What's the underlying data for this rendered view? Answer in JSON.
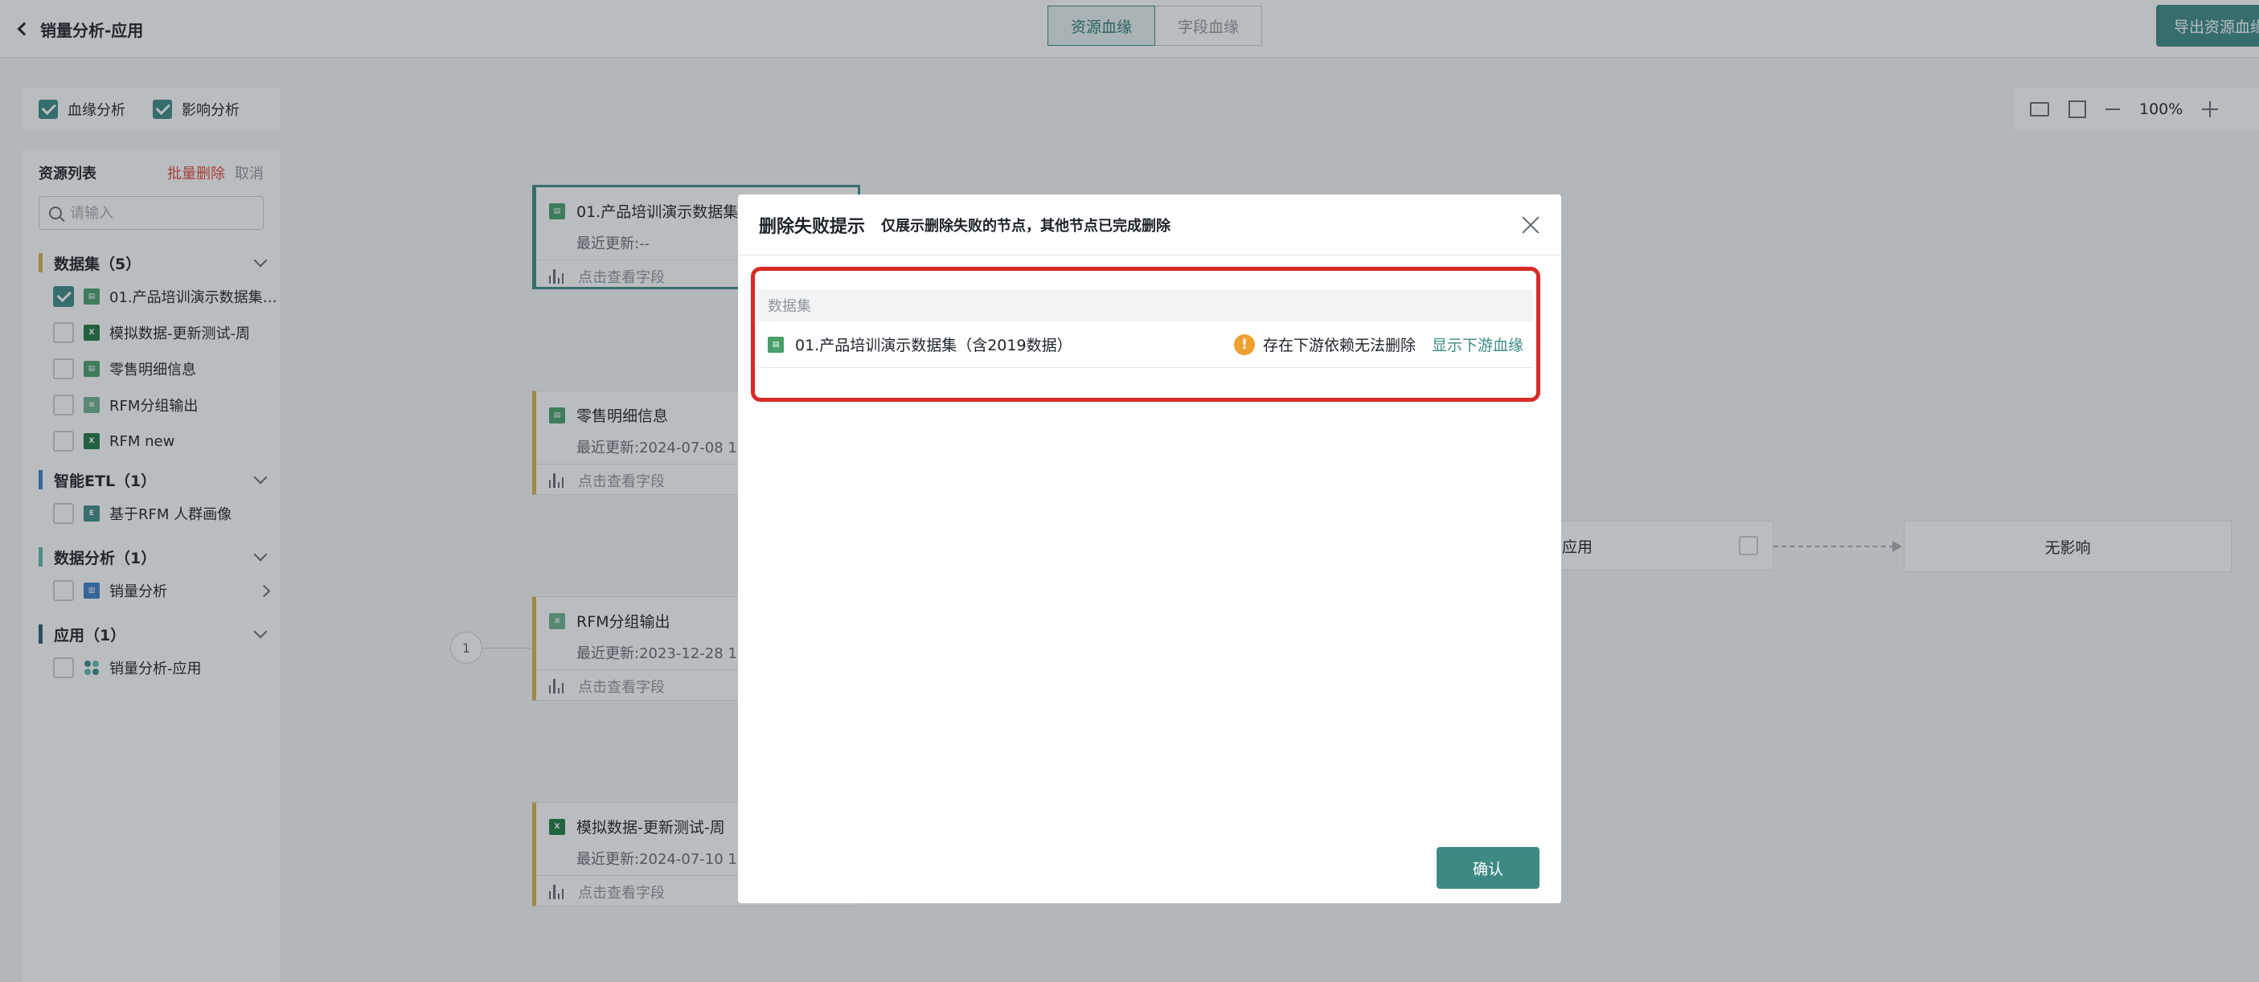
{
  "header": {
    "title": "销量分析-应用",
    "tabs": [
      {
        "label": "资源血缘",
        "active": true
      },
      {
        "label": "字段血缘",
        "active": false
      }
    ],
    "export_label": "导出资源血缘"
  },
  "analysis_options": {
    "lineage_label": "血缘分析",
    "lineage_checked": true,
    "impact_label": "影响分析",
    "impact_checked": true
  },
  "resource_panel": {
    "title": "资源列表",
    "batch_delete": "批量删除",
    "cancel": "取消",
    "search_placeholder": "请输入",
    "groups": [
      {
        "label": "数据集（5）",
        "color": "#d9b44a",
        "items": [
          {
            "label": "01.产品培训演示数据集（含2019数据）",
            "icon": "sheet-icon",
            "checked": true
          },
          {
            "label": "模拟数据-更新测试-周",
            "icon": "excel-icon",
            "checked": false
          },
          {
            "label": "零售明细信息",
            "icon": "sheet-icon",
            "checked": false
          },
          {
            "label": "RFM分组输出",
            "icon": "rfm-icon",
            "checked": false
          },
          {
            "label": "RFM new",
            "icon": "excel-icon",
            "checked": false
          }
        ]
      },
      {
        "label": "智能ETL（1）",
        "color": "#3c7fc6",
        "items": [
          {
            "label": "基于RFM 人群画像",
            "icon": "etl-icon",
            "checked": false
          }
        ]
      },
      {
        "label": "数据分析（1）",
        "color": "#5fb8b0",
        "items": [
          {
            "label": "销量分析",
            "icon": "analysis-icon",
            "checked": false
          }
        ]
      },
      {
        "label": "应用（1）",
        "color": "#2f5e6e",
        "items": [
          {
            "label": "销量分析-应用",
            "icon": "app-icon",
            "checked": false
          }
        ]
      }
    ]
  },
  "canvas": {
    "zoom_label": "100%",
    "count_badge": "1",
    "fields_label": "点击查看字段",
    "nodes": [
      {
        "name": "01.产品培训演示数据集",
        "updated": "最近更新:--"
      },
      {
        "name": "零售明细信息",
        "updated": "最近更新:2024-07-08 1"
      },
      {
        "name": "RFM分组输出",
        "updated": "最近更新:2023-12-28 1"
      },
      {
        "name": "模拟数据-更新测试-周",
        "updated": "最近更新:2024-07-10 1"
      }
    ],
    "app_node_label": "应用",
    "no_impact_label": "无影响"
  },
  "modal": {
    "title": "删除失败提示",
    "subtitle": "仅展示删除失败的节点，其他节点已完成删除",
    "table_header": "数据集",
    "rows": [
      {
        "name": "01.产品培训演示数据集（含2019数据）",
        "reason": "存在下游依赖无法删除",
        "link": "显示下游血缘"
      }
    ],
    "confirm_label": "确认"
  },
  "colors": {
    "accent": "#3d8a85",
    "danger": "#e0483e",
    "highlight": "#d92b26",
    "warning": "#f0a02f"
  }
}
